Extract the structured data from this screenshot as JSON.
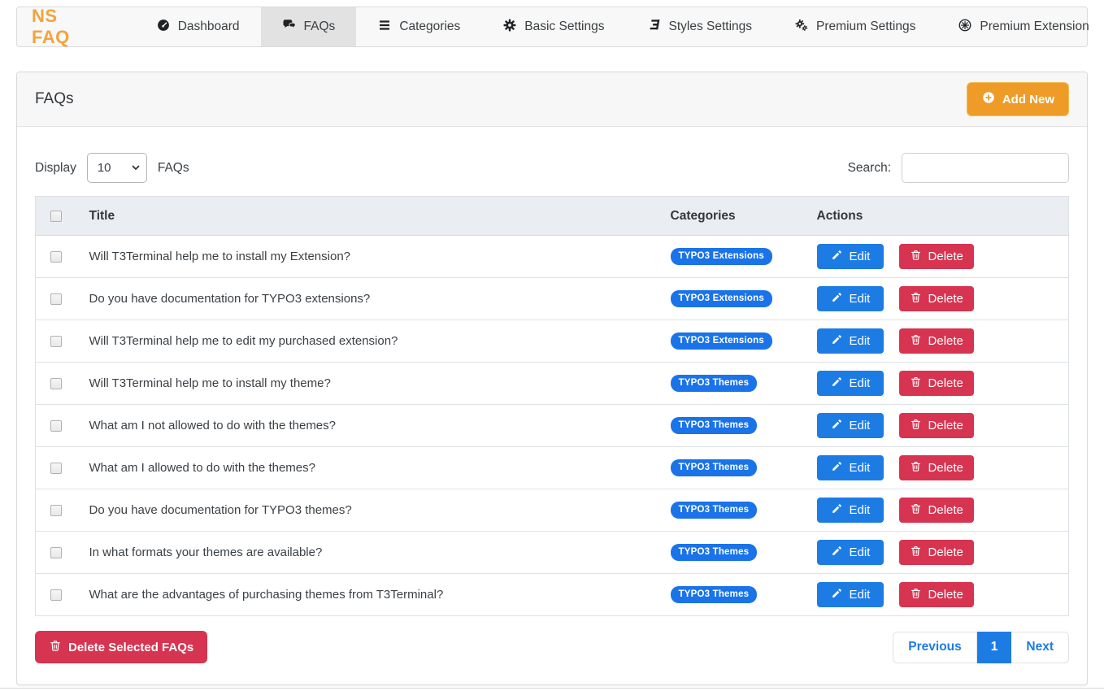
{
  "nav": {
    "brand": "NS FAQ",
    "items": [
      {
        "label": "Dashboard",
        "icon": "dashboard-icon",
        "active": false
      },
      {
        "label": "FAQs",
        "icon": "comments-icon",
        "active": true
      },
      {
        "label": "Categories",
        "icon": "list-icon",
        "active": false
      },
      {
        "label": "Basic Settings",
        "icon": "gear-icon",
        "active": false
      },
      {
        "label": "Styles Settings",
        "icon": "css3-icon",
        "active": false
      },
      {
        "label": "Premium Settings",
        "icon": "gears-icon",
        "active": false
      },
      {
        "label": "Premium Extension",
        "icon": "circle-asterisk-icon",
        "active": false
      }
    ]
  },
  "panel": {
    "title": "FAQs",
    "add_new_label": "Add New"
  },
  "controls": {
    "display_label": "Display",
    "display_value": "10",
    "display_suffix": "FAQs",
    "search_label": "Search:",
    "search_value": ""
  },
  "table": {
    "headers": {
      "title": "Title",
      "categories": "Categories",
      "actions": "Actions"
    },
    "edit_label": "Edit",
    "delete_label": "Delete",
    "rows": [
      {
        "title": "Will T3Terminal help me to install my Extension?",
        "category": "TYPO3 Extensions"
      },
      {
        "title": "Do you have documentation for TYPO3 extensions?",
        "category": "TYPO3 Extensions"
      },
      {
        "title": "Will T3Terminal help me to edit my purchased extension?",
        "category": "TYPO3 Extensions"
      },
      {
        "title": "Will T3Terminal help me to install my theme?",
        "category": "TYPO3 Themes"
      },
      {
        "title": "What am I not allowed to do with the themes?",
        "category": "TYPO3 Themes"
      },
      {
        "title": "What am I allowed to do with the themes?",
        "category": "TYPO3 Themes"
      },
      {
        "title": "Do you have documentation for TYPO3 themes?",
        "category": "TYPO3 Themes"
      },
      {
        "title": "In what formats your themes are available?",
        "category": "TYPO3 Themes"
      },
      {
        "title": "What are the advantages of purchasing themes from T3Terminal?",
        "category": "TYPO3 Themes"
      }
    ]
  },
  "footer": {
    "delete_selected_label": "Delete Selected FAQs",
    "pagination": {
      "previous": "Previous",
      "current_page": "1",
      "next": "Next"
    }
  },
  "colors": {
    "brand_orange": "#f2a33c",
    "add_new_orange": "#ee9c27",
    "badge_blue": "#1a73e8",
    "edit_blue": "#1d7ce4",
    "delete_red": "#d63450",
    "pagination_blue": "#1d7ce4",
    "nav_bg": "#f8f8f8",
    "nav_active_bg": "#e2e2e2",
    "table_header_bg": "#eaedf1"
  }
}
